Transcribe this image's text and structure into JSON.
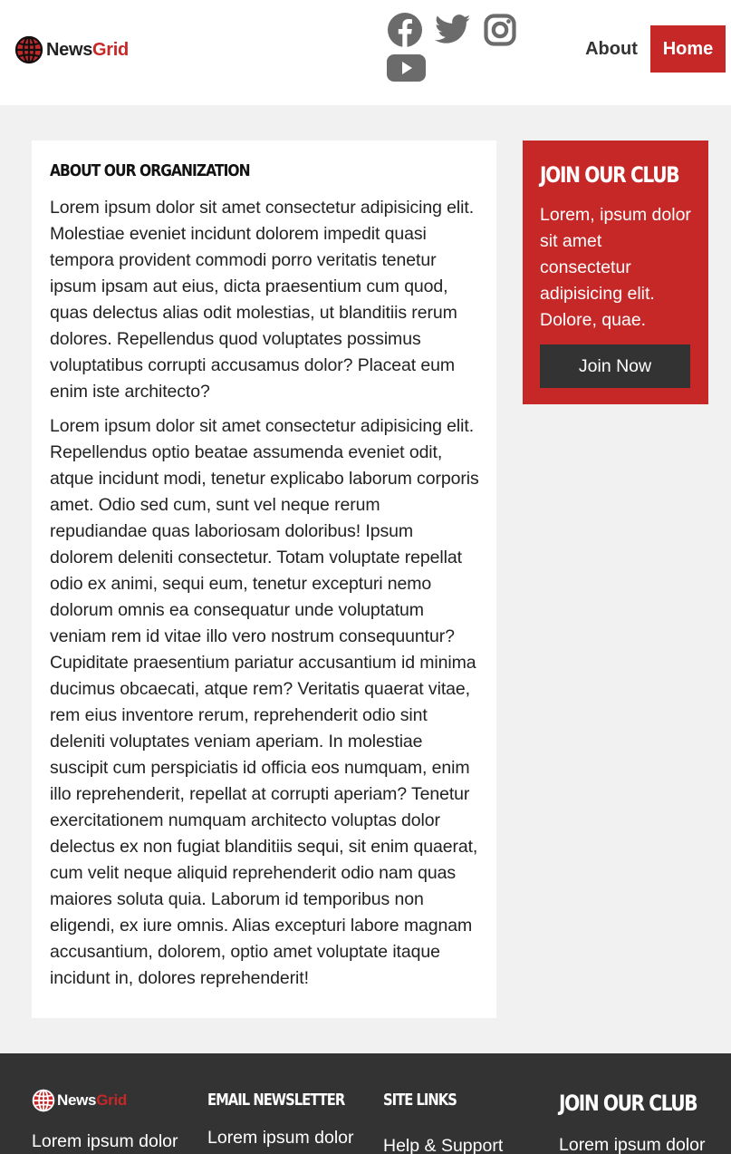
{
  "brand": {
    "name_main": "News",
    "name_accent": "Grid",
    "accent_color": "#c62828"
  },
  "social": [
    "facebook-icon",
    "twitter-icon",
    "instagram-icon",
    "youtube-icon"
  ],
  "nav": {
    "about": "About",
    "home": "Home"
  },
  "about": {
    "title": "About Our Organization",
    "paragraphs": [
      "Lorem ipsum dolor sit amet consectetur adipisicing elit. Molestiae eveniet incidunt dolorem impedit quasi tempora provident commodi porro veritatis tenetur ipsum ipsam aut eius, dicta praesentium cum quod, quas delectus alias odit molestias, ut blanditiis rerum dolores. Repellendus quod voluptates possimus voluptatibus corrupti accusamus dolor? Placeat eum enim iste architecto?",
      "Lorem ipsum dolor sit amet consectetur adipisicing elit. Repellendus optio beatae assumenda eveniet odit, atque incidunt modi, tenetur explicabo laborum corporis amet. Odio sed cum, sunt vel neque rerum repudiandae quas laboriosam doloribus! Ipsum dolorem deleniti consectetur. Totam voluptate repellat odio ex animi, sequi eum, tenetur excepturi nemo dolorum omnis ea consequatur unde voluptatum veniam rem id vitae illo vero nostrum consequuntur? Cupiditate praesentium pariatur accusantium id minima ducimus obcaecati, atque rem? Veritatis quaerat vitae, rem eius inventore rerum, reprehenderit odio sint deleniti voluptates veniam aperiam. In molestiae suscipit cum perspiciatis id officia eos numquam, enim illo reprehenderit, repellat at corrupti aperiam? Tenetur exercitationem numquam architecto voluptas dolor delectus ex non fugiat blanditiis sequi, sit enim quaerat, cum velit neque aliquid reprehenderit odio nam quas maiores soluta quia. Laborum id temporibus non eligendi, ex iure omnis. Alias excepturi labore magnam accusantium, dolorem, optio amet voluptate itaque incidunt in, dolores reprehenderit!"
    ]
  },
  "club": {
    "title": "Join Our Club",
    "text": "Lorem, ipsum dolor sit amet consectetur adipisicing elit. Dolore, quae.",
    "button": "Join Now"
  },
  "footer": {
    "brand_text": "Lorem ipsum dolor",
    "newsletter_title": "Email Newsletter",
    "newsletter_text": "Lorem ipsum dolor",
    "sitelinks_title": "Site Links",
    "sitelinks_first": "Help & Support",
    "club_title": "Join Our Club",
    "club_text": "Lorem ipsum dolor"
  },
  "colors": {
    "header_bg": "#ffffff",
    "page_bg": "#f1f1f1",
    "footer_bg": "#333333",
    "button_dark": "#333333"
  }
}
